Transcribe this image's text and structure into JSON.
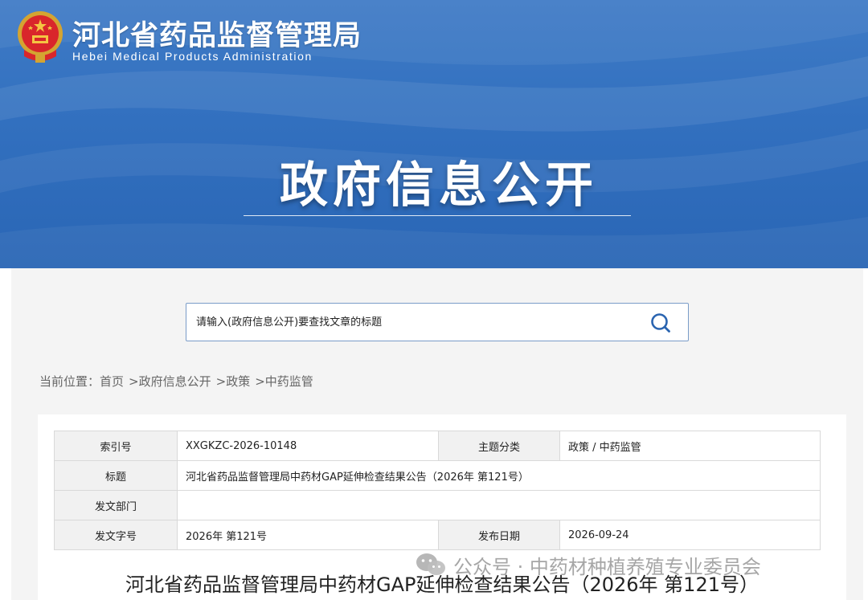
{
  "header": {
    "agency_name": "河北省药品监督管理局",
    "agency_name_en": "Hebei Medical Products Administration",
    "emblem_icon": "national-emblem-icon",
    "section_title": "政府信息公开",
    "banner_color": "#3270bf"
  },
  "search": {
    "placeholder": "请输入(政府信息公开)要查找文章的标题",
    "value": "",
    "icon": "search-icon"
  },
  "breadcrumb": {
    "prefix": "当前位置：",
    "items": [
      "首页",
      "政府信息公开",
      "政策",
      "中药监管"
    ],
    "separator": ">"
  },
  "metadata": {
    "rows": [
      {
        "label_a": "索引号",
        "value_a": "XXGKZC-2026-10148",
        "label_b": "主题分类",
        "value_b": "政策 / 中药监管"
      },
      {
        "label": "标题",
        "value": "河北省药品监督管理局中药材GAP延伸检查结果公告（2026年 第121号）"
      },
      {
        "label": "发文部门",
        "value": ""
      },
      {
        "label_a": "发文字号",
        "value_a": "2026年 第121号",
        "label_b": "发布日期",
        "value_b": "2026-09-24"
      }
    ]
  },
  "document": {
    "title": "河北省药品监督管理局中药材GAP延伸检查结果公告（2026年 第121号）"
  },
  "watermark": {
    "icon": "wechat-icon",
    "text": "公众号 · 中药材种植养殖专业委员会"
  }
}
